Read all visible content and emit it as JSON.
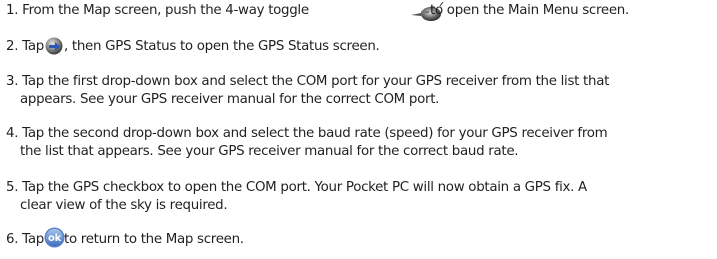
{
  "steps": [
    {
      "number": "1.",
      "lines": [
        "From the Map screen, push the 4-way toggle",
        "to open the Main Menu screen."
      ]
    },
    {
      "number": "2.",
      "lines": [
        "Tap",
        ", then GPS Status to open the GPS Status screen."
      ]
    },
    {
      "number": "3.",
      "lines": [
        "Tap the first drop-down box and select the COM port for your GPS receiver from the list that",
        "appears. See your GPS receiver manual for the correct COM port."
      ]
    },
    {
      "number": "4.",
      "lines": [
        "Tap the second drop-down box and select the baud rate (speed) for your GPS receiver from",
        "the list that appears. See your GPS receiver manual for the correct baud rate."
      ]
    },
    {
      "number": "5.",
      "lines": [
        "Tap the GPS checkbox to open the COM port. Your Pocket PC will now obtain a GPS fix. A",
        "clear view of the sky is required."
      ]
    },
    {
      "number": "6.",
      "lines": [
        "Tap",
        "to return to the Map screen."
      ]
    }
  ],
  "icons": {
    "toggle": "four-way-toggle-icon",
    "menu": "menu-arrow-icon",
    "ok": "ok-button-icon",
    "ok_label": "ok"
  }
}
